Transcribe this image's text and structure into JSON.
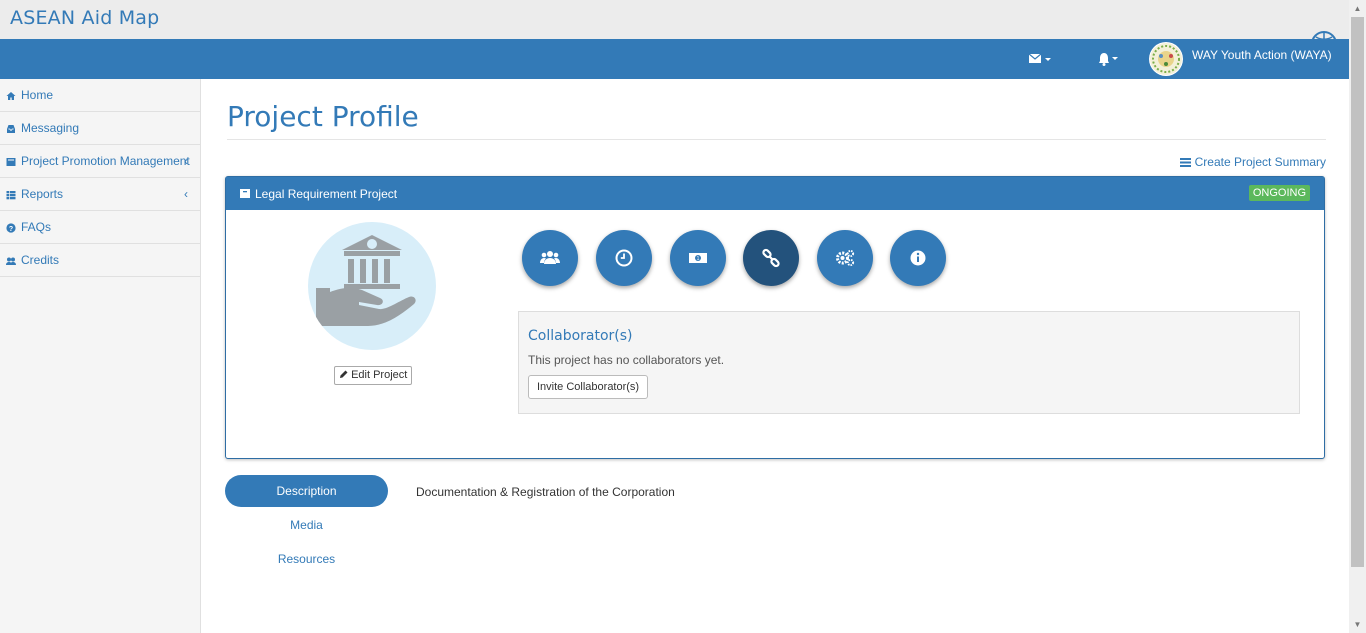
{
  "brand": {
    "name": "ASEAN Aid Map"
  },
  "navbar": {
    "mail_icon": "envelope-icon",
    "bell_icon": "bell-icon",
    "user_name": "WAY Youth Action (WAYA)"
  },
  "sidebar": {
    "items": [
      {
        "label": "Home",
        "icon": "home-icon"
      },
      {
        "label": "Messaging",
        "icon": "inbox-icon"
      },
      {
        "label": "Project Promotion Management",
        "icon": "folder-icon",
        "chevron": "‹"
      },
      {
        "label": "Reports",
        "icon": "table-icon",
        "chevron": "‹"
      },
      {
        "label": "FAQs",
        "icon": "question-icon"
      },
      {
        "label": "Credits",
        "icon": "users-icon"
      }
    ]
  },
  "page": {
    "title": "Project Profile",
    "summary_link": "Create Project Summary"
  },
  "project": {
    "name": "Legal Requirement Project",
    "status": "ONGOING",
    "status_color": "#5cb85c",
    "edit_label": "Edit Project",
    "actions": [
      {
        "icon": "users-icon"
      },
      {
        "icon": "clock-icon"
      },
      {
        "icon": "money-icon"
      },
      {
        "icon": "link-icon",
        "active": true
      },
      {
        "icon": "cogs-icon"
      },
      {
        "icon": "info-icon"
      }
    ],
    "collaborators": {
      "title": "Collaborator(s)",
      "empty_text": "This project has no collaborators yet.",
      "invite_label": "Invite Collaborator(s)"
    }
  },
  "tabs": {
    "items": [
      {
        "label": "Description",
        "active": true
      },
      {
        "label": "Media"
      },
      {
        "label": "Resources"
      }
    ],
    "description_text": "Documentation & Registration of the Corporation"
  },
  "colors": {
    "primary": "#337ab7",
    "primary_dark": "#23527c",
    "success": "#5cb85c"
  }
}
